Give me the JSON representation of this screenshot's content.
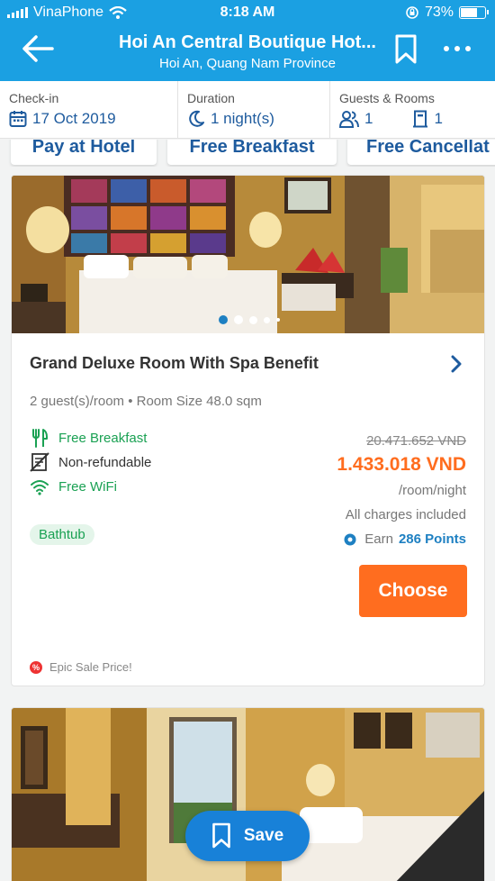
{
  "status_bar": {
    "carrier": "VinaPhone",
    "time": "8:18 AM",
    "battery_percent": "73%",
    "battery_level": 0.73
  },
  "header": {
    "title": "Hoi An Central Boutique Hot...",
    "subtitle": "Hoi An, Quang Nam Province",
    "back_icon": "arrow-left-icon",
    "bookmark_icon": "bookmark-icon",
    "more_icon": "more-dots-icon"
  },
  "search": {
    "checkin_label": "Check-in",
    "checkin_value": "17 Oct 2019",
    "duration_label": "Duration",
    "duration_value": "1 night(s)",
    "guests_label": "Guests & Rooms",
    "guests_value": "1",
    "rooms_value": "1"
  },
  "filters": [
    "Pay at Hotel",
    "Free Breakfast",
    "Free Cancellat"
  ],
  "room": {
    "name": "Grand Deluxe Room With Spa Benefit",
    "meta": "2 guest(s)/room • Room Size 48.0 sqm",
    "features": [
      {
        "label": "Free Breakfast",
        "icon": "cutlery-icon"
      },
      {
        "label": "Non-refundable",
        "icon": "non-refundable-icon"
      },
      {
        "label": "Free WiFi",
        "icon": "wifi-icon"
      }
    ],
    "tag": "Bathtub",
    "old_price": "20.471.652 VND",
    "price": "1.433.018 VND",
    "per": "/room/night",
    "charges": "All charges included",
    "earn_prefix": "Earn",
    "points": "286 Points",
    "choose_label": "Choose",
    "sale_label": "Epic Sale Price!",
    "sale_badge": "%",
    "photo_count": 5,
    "photo_index": 0
  },
  "save_label": "Save",
  "colors": {
    "brand": "#1ba0e2",
    "link": "#1e5b9e",
    "accent": "#ff6d1f",
    "green": "#1aa153",
    "save": "#1881d8"
  }
}
